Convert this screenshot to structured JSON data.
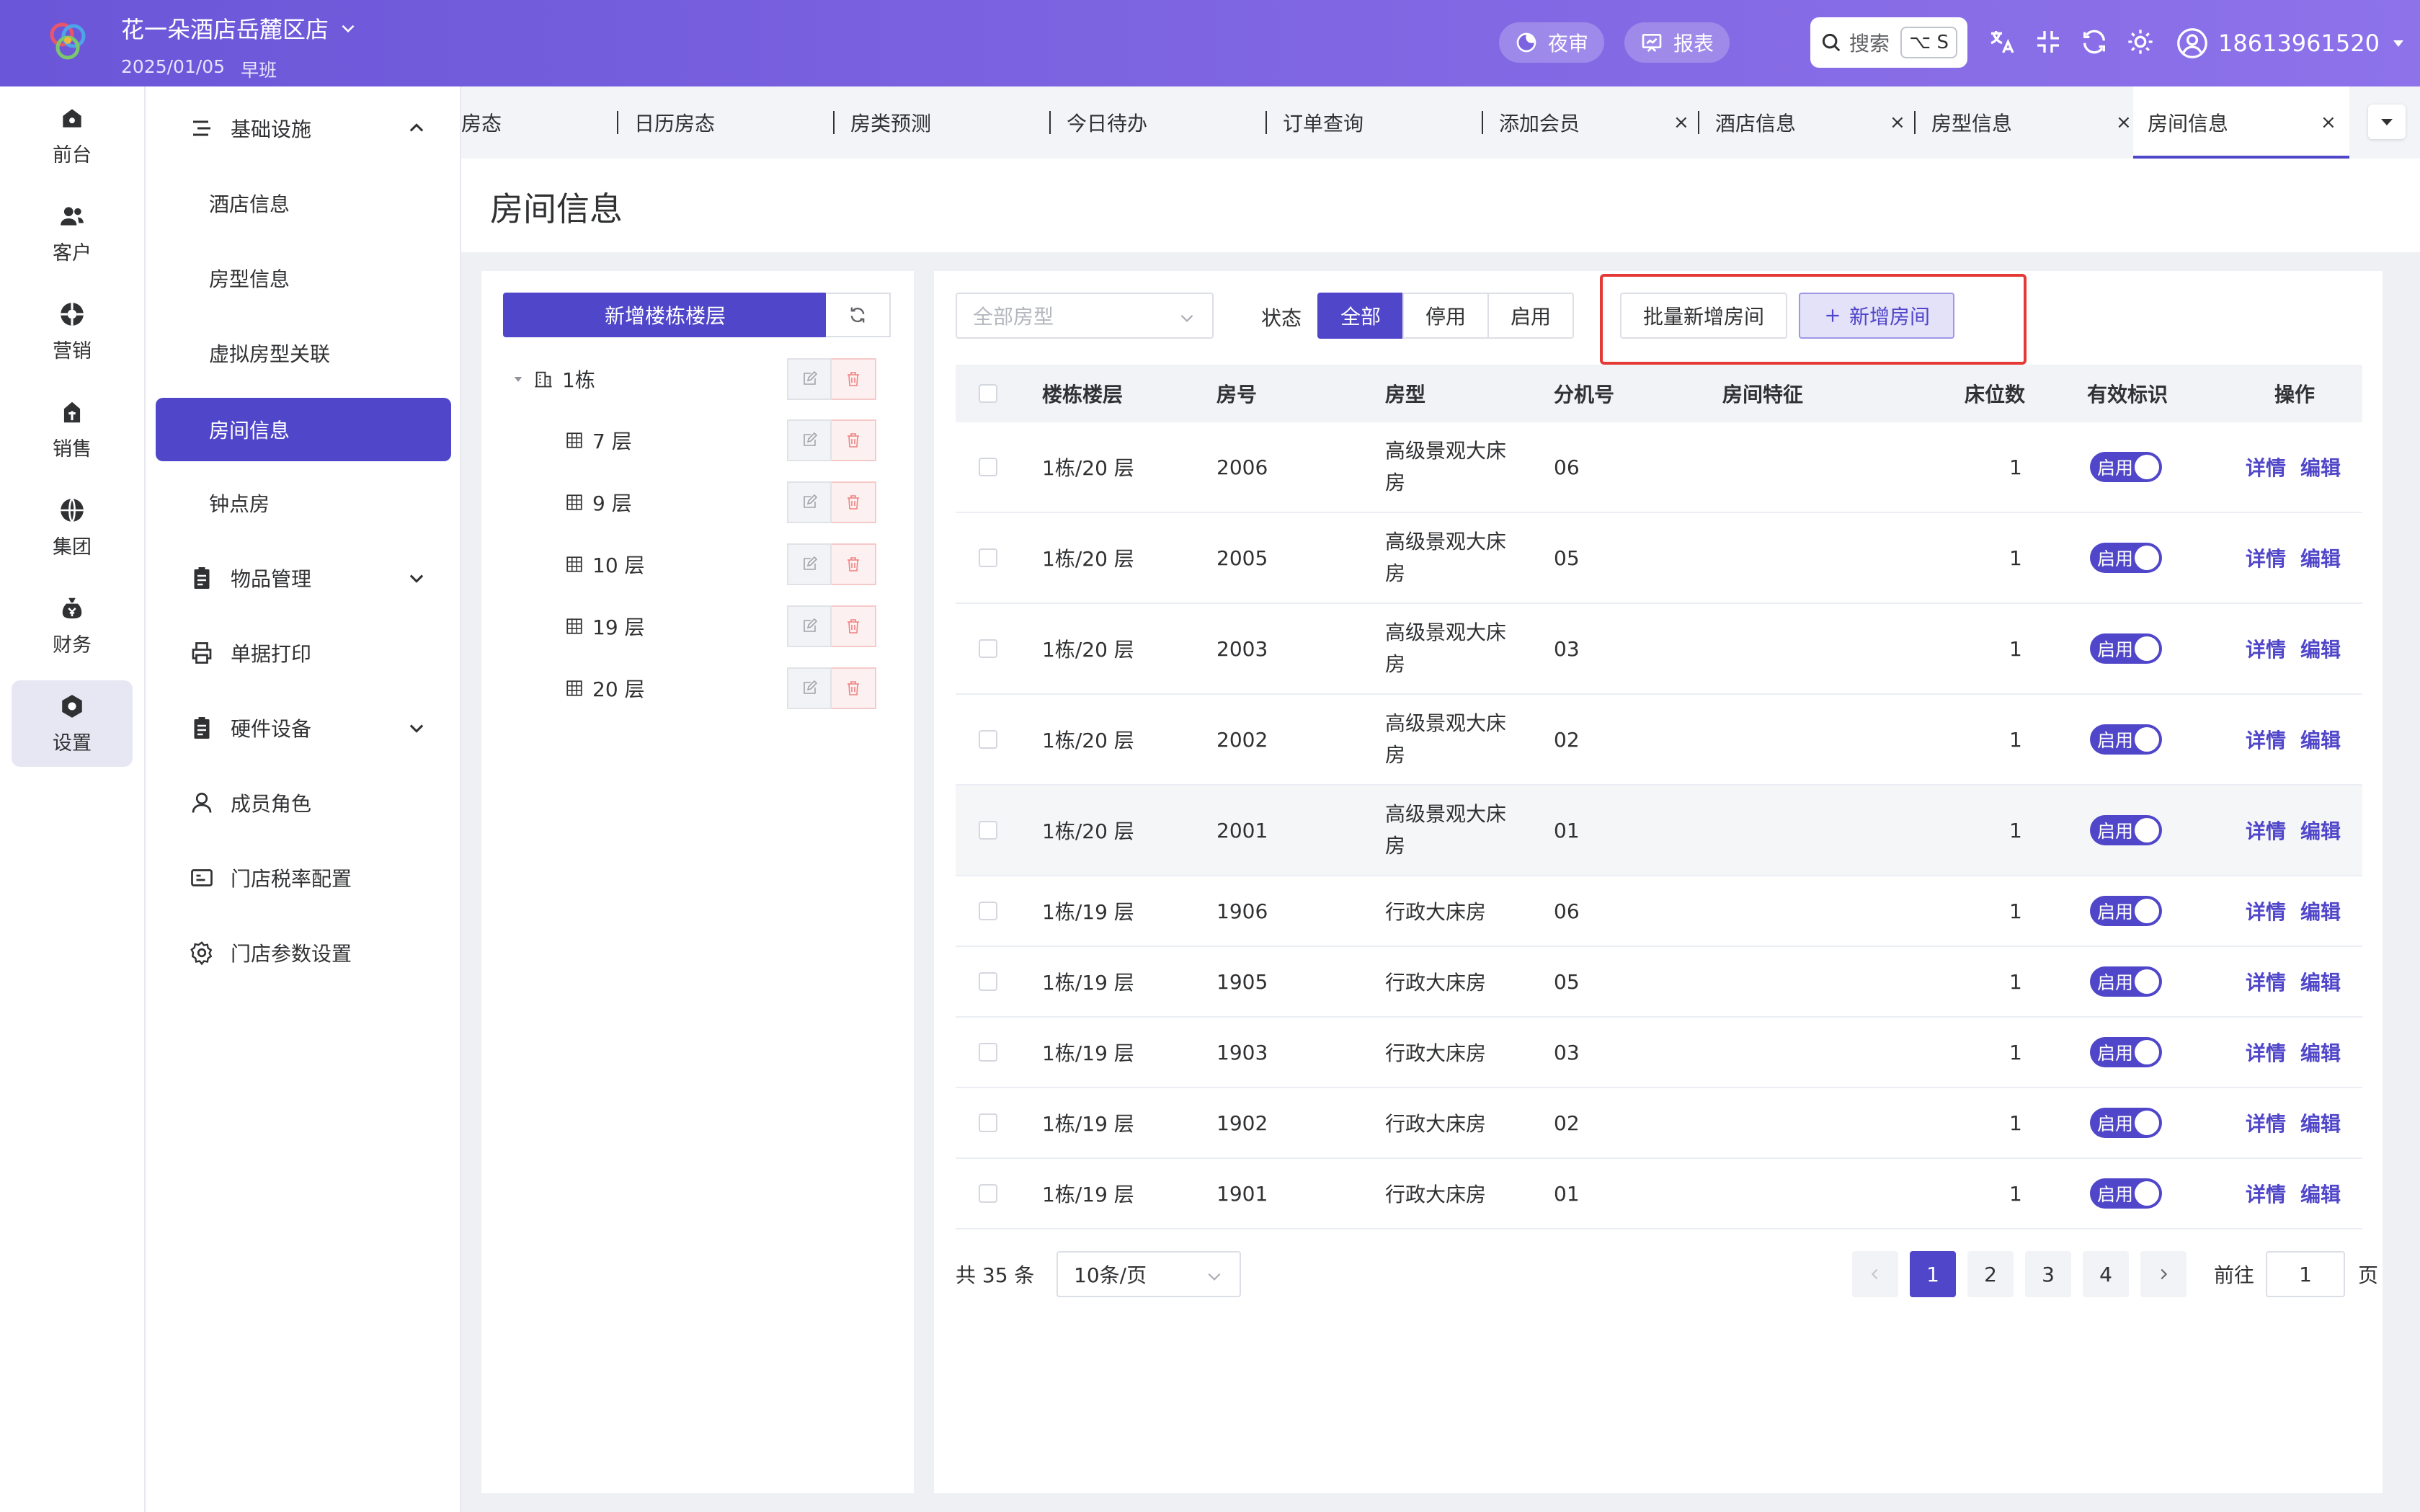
{
  "header": {
    "hotel_name": "花一朵酒店岳麓区店",
    "date": "2025/01/05",
    "shift": "早班",
    "night_audit": "夜审",
    "report": "报表",
    "search_label": "搜索",
    "search_shortcut": "⌥ S",
    "user_phone": "18613961520"
  },
  "rail": [
    {
      "label": "前台",
      "icon": "home-icon"
    },
    {
      "label": "客户",
      "icon": "users-icon"
    },
    {
      "label": "营销",
      "icon": "marketing-icon"
    },
    {
      "label": "销售",
      "icon": "sales-icon"
    },
    {
      "label": "集团",
      "icon": "globe-icon"
    },
    {
      "label": "财务",
      "icon": "money-bag-icon"
    },
    {
      "label": "设置",
      "icon": "settings-icon",
      "active": true
    }
  ],
  "submenu": {
    "basic": "基础设施",
    "hotel_info": "酒店信息",
    "room_type_info": "房型信息",
    "virtual_room": "虚拟房型关联",
    "room_info": "房间信息",
    "hourly_room": "钟点房",
    "goods": "物品管理",
    "print": "单据打印",
    "hardware": "硬件设备",
    "roles": "成员角色",
    "tax": "门店税率配置",
    "params": "门店参数设置"
  },
  "tabs": {
    "t1": "房态",
    "t2": "日历房态",
    "t3": "房类预测",
    "t4": "今日待办",
    "t5": "订单查询",
    "t6": "添加会员",
    "t7": "酒店信息",
    "t8": "房型信息",
    "t9": "房间信息",
    "close": "×"
  },
  "page_title": "房间信息",
  "tree": {
    "add_button": "新增楼栋楼层",
    "building": "1栋",
    "floors": [
      "7 层",
      "9 层",
      "10 层",
      "19 层",
      "20 层"
    ]
  },
  "filters": {
    "room_type_placeholder": "全部房型",
    "status_label": "状态",
    "status_all": "全部",
    "status_disabled": "停用",
    "status_enabled": "启用",
    "batch_add": "批量新增房间",
    "add_room": "新增房间"
  },
  "table": {
    "headers": {
      "floor": "楼栋楼层",
      "room_no": "房号",
      "room_type": "房型",
      "ext": "分机号",
      "features": "房间特征",
      "beds": "床位数",
      "valid": "有效标识",
      "ops": "操作"
    },
    "switch_label": "启用",
    "detail": "详情",
    "edit": "编辑",
    "rows": [
      {
        "floor": "1栋/20 层",
        "room": "2006",
        "type1": "高级景观大床",
        "type2": "房",
        "ext": "06",
        "beds": "1"
      },
      {
        "floor": "1栋/20 层",
        "room": "2005",
        "type1": "高级景观大床",
        "type2": "房",
        "ext": "05",
        "beds": "1"
      },
      {
        "floor": "1栋/20 层",
        "room": "2003",
        "type1": "高级景观大床",
        "type2": "房",
        "ext": "03",
        "beds": "1"
      },
      {
        "floor": "1栋/20 层",
        "room": "2002",
        "type1": "高级景观大床",
        "type2": "房",
        "ext": "02",
        "beds": "1"
      },
      {
        "floor": "1栋/20 层",
        "room": "2001",
        "type1": "高级景观大床",
        "type2": "房",
        "ext": "01",
        "beds": "1"
      },
      {
        "floor": "1栋/19 层",
        "room": "1906",
        "type1": "行政大床房",
        "type2": "",
        "ext": "06",
        "beds": "1"
      },
      {
        "floor": "1栋/19 层",
        "room": "1905",
        "type1": "行政大床房",
        "type2": "",
        "ext": "05",
        "beds": "1"
      },
      {
        "floor": "1栋/19 层",
        "room": "1903",
        "type1": "行政大床房",
        "type2": "",
        "ext": "03",
        "beds": "1"
      },
      {
        "floor": "1栋/19 层",
        "room": "1902",
        "type1": "行政大床房",
        "type2": "",
        "ext": "02",
        "beds": "1"
      },
      {
        "floor": "1栋/19 层",
        "room": "1901",
        "type1": "行政大床房",
        "type2": "",
        "ext": "01",
        "beds": "1"
      }
    ]
  },
  "pagination": {
    "total": "共 35 条",
    "page_size": "10条/页",
    "pages": [
      "1",
      "2",
      "3",
      "4"
    ],
    "goto_label": "前往",
    "goto_value": "1",
    "page_unit": "页"
  },
  "colors": {
    "primary": "#5046c9",
    "highlight": "#e53935"
  }
}
